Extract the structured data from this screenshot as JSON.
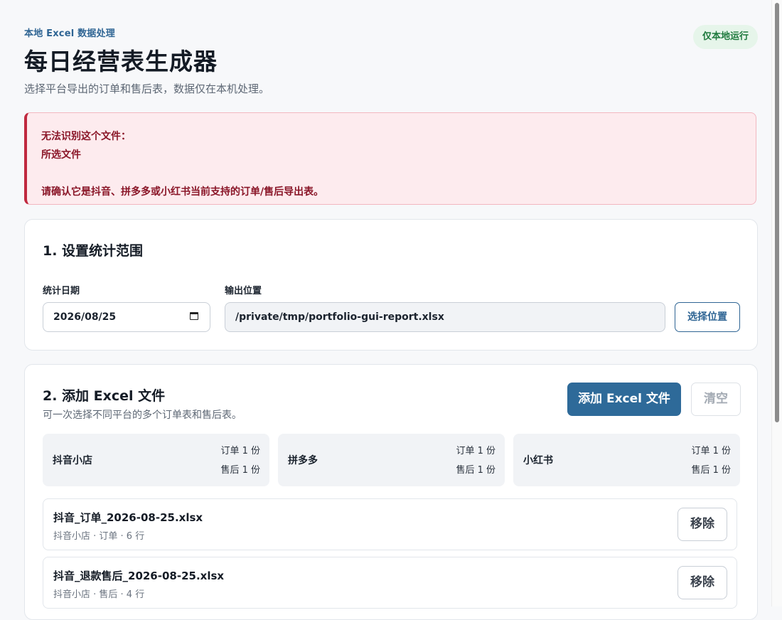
{
  "header": {
    "eyebrow": "本地 Excel 数据处理",
    "title": "每日经营表生成器",
    "subtitle": "选择平台导出的订单和售后表，数据仅在本机处理。",
    "badge": "仅本地运行"
  },
  "alert": {
    "line1": "无法识别这个文件：",
    "line2": "所选文件",
    "line3": "请确认它是抖音、拼多多或小红书当前支持的订单/售后导出表。"
  },
  "range_section": {
    "title": "1. 设置统计范围",
    "date_label": "统计日期",
    "date_value": "2026/08/25",
    "output_label": "输出位置",
    "output_path": "/private/tmp/portfolio-gui-report.xlsx",
    "choose_button": "选择位置"
  },
  "files_section": {
    "title": "2. 添加 Excel 文件",
    "subtitle": "可一次选择不同平台的多个订单表和售后表。",
    "add_button": "添加 Excel 文件",
    "clear_button": "清空",
    "platforms": [
      {
        "name": "抖音小店",
        "orders": "订单 1 份",
        "aftersales": "售后 1 份"
      },
      {
        "name": "拼多多",
        "orders": "订单 1 份",
        "aftersales": "售后 1 份"
      },
      {
        "name": "小红书",
        "orders": "订单 1 份",
        "aftersales": "售后 1 份"
      }
    ],
    "files": [
      {
        "name": "抖音_订单_2026-08-25.xlsx",
        "meta": "抖音小店 · 订单 · 6 行",
        "remove": "移除"
      },
      {
        "name": "抖音_退款售后_2026-08-25.xlsx",
        "meta": "抖音小店 · 售后 · 4 行",
        "remove": "移除"
      }
    ]
  },
  "icons": {
    "calendar": "calendar-icon"
  },
  "colors": {
    "accent": "#2e6a99",
    "error": "#c0293f",
    "success": "#1f7a3e"
  }
}
